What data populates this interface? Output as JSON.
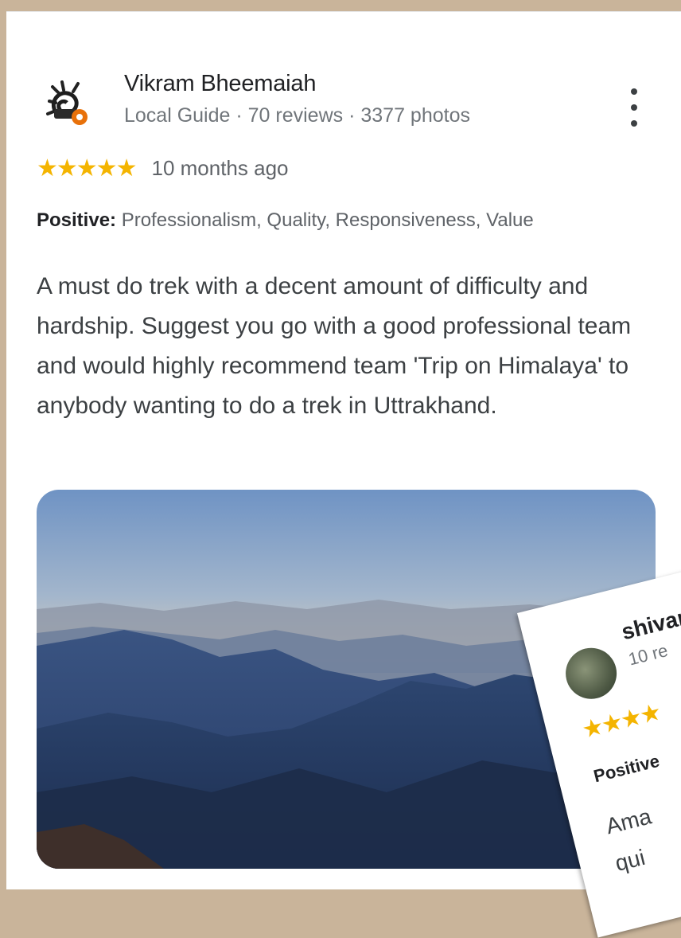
{
  "review": {
    "author_name": "Vikram Bheemaiah",
    "author_meta": "Local Guide · 70 reviews · 3377 photos",
    "rating": 5,
    "stars": "★★★★★",
    "time_ago": "10 months ago",
    "positive_label": "Positive:",
    "positive_values": " Professionalism, Quality, Responsiveness, Value",
    "text": "A must do trek with a decent amount of difficulty and hardship. Suggest you go with a good professional team and would highly recommend team 'Trip on Himalaya' to anybody wanting to do a trek in Uttrakhand.",
    "more_icon": "more-vert-icon",
    "photo": "mountain-sunrise-photo"
  },
  "overlap_card": {
    "author_name": "shivar",
    "author_meta": "10 re",
    "stars": "★★★★",
    "positive_label": "Positive",
    "text_start": "Ama",
    "text_next": "qui"
  },
  "colors": {
    "star": "#f4b400",
    "background": "#c9b49a",
    "card": "#ffffff"
  }
}
